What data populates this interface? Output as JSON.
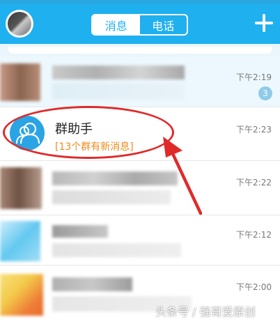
{
  "header": {
    "tabs": [
      {
        "label": "消息",
        "active": true
      },
      {
        "label": "电话",
        "active": false
      }
    ],
    "add_icon": "plus-icon",
    "accent_color": "#1fb0ef"
  },
  "conversations": [
    {
      "time": "下午2:19",
      "badge": "3"
    },
    {
      "title": "群助手",
      "subtitle": "[13个群有新消息]",
      "time": "下午2:23",
      "icon": "group-helper-icon"
    },
    {
      "time": "下午2:22"
    },
    {
      "time": "下午2:12"
    },
    {
      "time": "下午2:00"
    }
  ],
  "annotation": {
    "color": "#e02a2a"
  },
  "watermark": "头条号 / 强哥爱原创"
}
